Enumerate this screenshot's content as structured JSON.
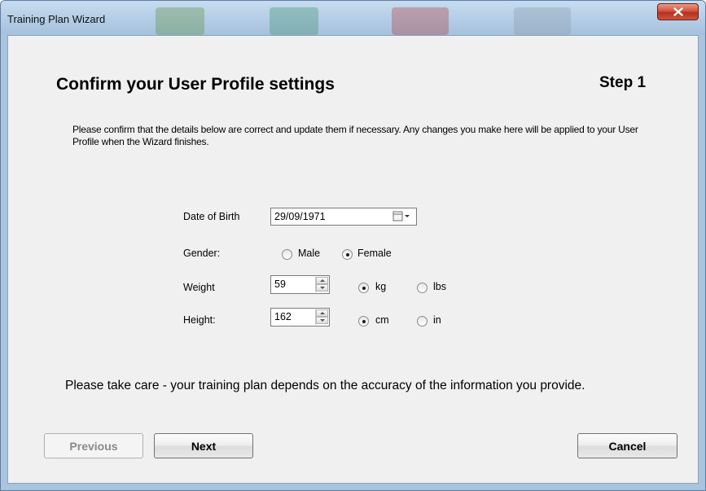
{
  "window": {
    "title": "Training Plan Wizard"
  },
  "header": {
    "heading": "Confirm your User Profile settings",
    "step": "Step 1"
  },
  "intro": "Please confirm that the details below are correct and update them if necessary.  Any changes you make here will be applied to your User Profile when the Wizard finishes.",
  "form": {
    "dob": {
      "label": "Date of Birth",
      "value": "29/09/1971",
      "icon": "calendar-dropdown-icon"
    },
    "gender": {
      "label": "Gender:",
      "options": [
        {
          "label": "Male",
          "selected": false
        },
        {
          "label": "Female",
          "selected": true
        }
      ]
    },
    "weight": {
      "label": "Weight",
      "value": "59",
      "units": [
        {
          "label": "kg",
          "selected": true
        },
        {
          "label": "lbs",
          "selected": false
        }
      ]
    },
    "height": {
      "label": "Height:",
      "value": "162",
      "units": [
        {
          "label": "cm",
          "selected": true
        },
        {
          "label": "in",
          "selected": false
        }
      ]
    }
  },
  "notice": "Please take care - your training plan depends on the accuracy of the information you provide.",
  "buttons": {
    "previous": "Previous",
    "next": "Next",
    "cancel": "Cancel"
  },
  "colors": {
    "titlebar": "#b4cde6",
    "client_background": "#f0f0f0",
    "close_button": "#c9553d"
  }
}
